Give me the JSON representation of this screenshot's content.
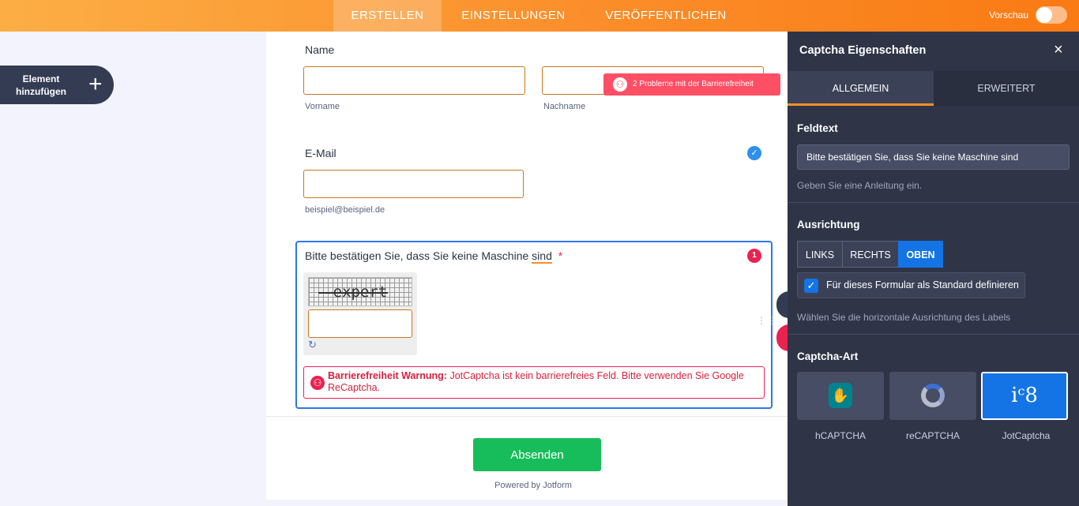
{
  "topbar": {
    "tabs": [
      {
        "label": "ERSTELLEN",
        "active": true
      },
      {
        "label": "EINSTELLUNGEN",
        "active": false
      },
      {
        "label": "VERÖFFENTLICHEN",
        "active": false
      }
    ],
    "preview_label": "Vorschau",
    "preview_on": false
  },
  "left": {
    "add_element_label": "Element hinzufügen",
    "add_icon": "+"
  },
  "form": {
    "name": {
      "label": "Name",
      "first_sublabel": "Vorname",
      "last_sublabel": "Nachname",
      "accessibility_badge": "2 Probleme mit der Barrierefreiheit"
    },
    "email": {
      "label": "E-Mail",
      "sublabel": "beispiel@beispiel.de"
    },
    "captcha": {
      "label_prefix": "Bitte bestätigen Sie, dass Sie keine Maschine",
      "label_last_word": "sind",
      "required_mark": "*",
      "error_count": "1",
      "captcha_word": "expert",
      "warning_title": "Barrierefreiheit Warnung:",
      "warning_text": "JotCaptcha ist kein barrierefreies Feld. Bitte verwenden Sie Google ReCaptcha."
    },
    "submit_label": "Absenden",
    "powered_by": "Powered by Jotform"
  },
  "panel": {
    "title": "Captcha Eigenschaften",
    "close_icon": "×",
    "tabs": [
      {
        "label": "ALLGEMEIN",
        "active": true
      },
      {
        "label": "ERWEITERT",
        "active": false
      }
    ],
    "field_text": {
      "title": "Feldtext",
      "value": "Bitte bestätigen Sie, dass Sie keine Maschine sind",
      "hint": "Geben Sie eine Anleitung ein."
    },
    "alignment": {
      "title": "Ausrichtung",
      "options": [
        "LINKS",
        "RECHTS",
        "OBEN"
      ],
      "selected": "OBEN",
      "default_label": "Für dieses Formular als Standard definieren",
      "default_checked": true,
      "hint": "Wählen Sie die horizontale Ausrichtung des Labels"
    },
    "captcha_type": {
      "title": "Captcha-Art",
      "options": [
        {
          "label": "hCAPTCHA",
          "icon": "hcaptcha-icon"
        },
        {
          "label": "reCAPTCHA",
          "icon": "recaptcha-icon"
        },
        {
          "label": "JotCaptcha",
          "icon": "jotcaptcha-icon",
          "icon_text": "iᶜ8"
        }
      ],
      "selected": "JotCaptcha"
    }
  },
  "colors": {
    "accent_orange": "#fb8e2a",
    "panel_bg": "#2f3547",
    "selected_blue": "#1474e6",
    "error_red": "#e8234f",
    "submit_green": "#18bd5b"
  }
}
